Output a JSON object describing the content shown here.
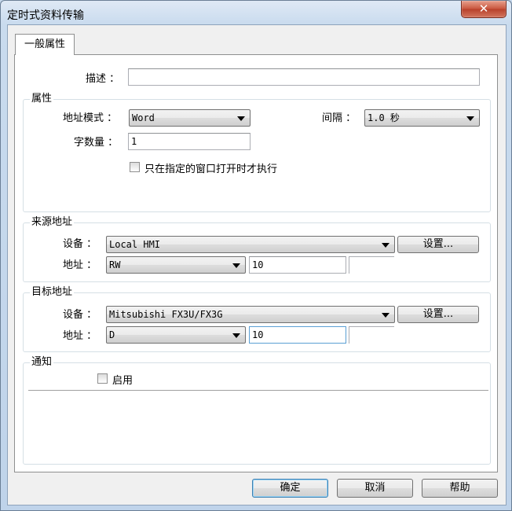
{
  "window": {
    "title": "定时式资料传输",
    "close_glyph": "✕"
  },
  "tab": {
    "label": "一般属性"
  },
  "description": {
    "label": "描述 ：",
    "value": ""
  },
  "properties": {
    "title": "属性",
    "address_mode_label": "地址模式 ：",
    "address_mode_value": "Word",
    "interval_label": "间隔 ：",
    "interval_value": "1.0  秒",
    "word_count_label": "字数量 ：",
    "word_count_value": "1",
    "only_window_label": "只在指定的窗口打开时才执行"
  },
  "source": {
    "title": "来源地址",
    "device_label": "设备 ：",
    "device_value": "Local HMI",
    "settings_label": "设置...",
    "address_label": "地址 ：",
    "address_type": "RW",
    "address_value": "10"
  },
  "target": {
    "title": "目标地址",
    "device_label": "设备 ：",
    "device_value": "Mitsubishi FX3U/FX3G",
    "settings_label": "设置...",
    "address_label": "地址 ：",
    "address_type": "D",
    "address_value": "10"
  },
  "notify": {
    "title": "通知",
    "enable_label": "启用"
  },
  "footer": {
    "ok_label": "确定",
    "cancel_label": "取消",
    "help_label": "帮助"
  }
}
